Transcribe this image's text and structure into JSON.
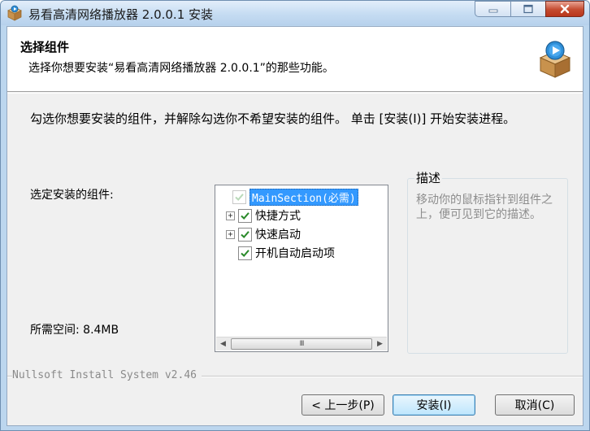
{
  "window": {
    "title": "易看高清网络播放器 2.0.0.1 安装"
  },
  "header": {
    "title": "选择组件",
    "subtitle": "选择你想要安装“易看高清网络播放器 2.0.0.1”的那些功能。"
  },
  "instructions": "勾选你想要安装的组件，并解除勾选你不希望安装的组件。 单击 [安装(I)] 开始安装进程。",
  "components": {
    "label": "选定安装的组件:",
    "items": [
      {
        "label": "MainSection(必需)",
        "checked": true,
        "disabled": true,
        "expandable": false,
        "selected": true
      },
      {
        "label": "快捷方式",
        "checked": true,
        "disabled": false,
        "expandable": true,
        "selected": false
      },
      {
        "label": "快速启动",
        "checked": true,
        "disabled": false,
        "expandable": true,
        "selected": false
      },
      {
        "label": "开机自动启动项",
        "checked": true,
        "disabled": false,
        "expandable": false,
        "selected": false
      }
    ],
    "scrollbar_thumb": "III"
  },
  "space_required": "所需空间: 8.4MB",
  "description": {
    "title": "描述",
    "text": "移动你的鼠标指针到组件之上，便可见到它的描述。"
  },
  "footer": {
    "brand": "Nullsoft Install System v2.46"
  },
  "buttons": {
    "back": "< 上一步(P)",
    "install": "安装(I)",
    "cancel": "取消(C)"
  },
  "colors": {
    "accent_check": "#2a8a2a",
    "selection": "#3399ff",
    "close_button": "#c44b2f"
  }
}
